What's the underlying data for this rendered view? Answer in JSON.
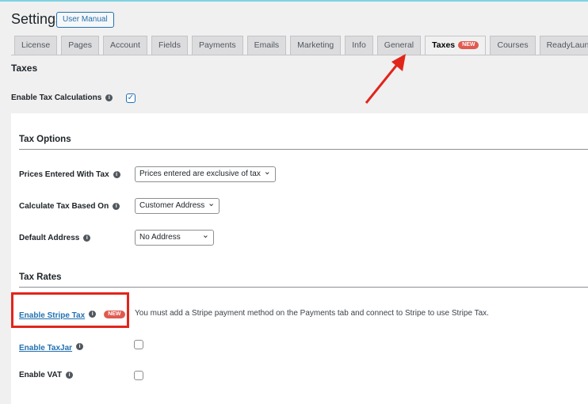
{
  "header": {
    "title": "Settings",
    "manual_button": "User Manual"
  },
  "tabs": [
    {
      "label": "License"
    },
    {
      "label": "Pages"
    },
    {
      "label": "Account"
    },
    {
      "label": "Fields"
    },
    {
      "label": "Payments"
    },
    {
      "label": "Emails"
    },
    {
      "label": "Marketing"
    },
    {
      "label": "Info"
    },
    {
      "label": "General"
    },
    {
      "label": "Taxes",
      "badge": "NEW",
      "active": true
    },
    {
      "label": "Courses"
    },
    {
      "label": "ReadyLaunch™"
    }
  ],
  "section_title": "Taxes",
  "enable_tax": {
    "label": "Enable Tax Calculations",
    "checked": true
  },
  "tax_options": {
    "heading": "Tax Options",
    "prices": {
      "label": "Prices Entered With Tax",
      "value": "Prices entered are exclusive of tax"
    },
    "calc": {
      "label": "Calculate Tax Based On",
      "value": "Customer Address"
    },
    "address": {
      "label": "Default Address",
      "value": "No Address"
    }
  },
  "tax_rates": {
    "heading": "Tax Rates",
    "stripe": {
      "label": "Enable Stripe Tax",
      "badge": "NEW",
      "note": "You must add a Stripe payment method on the Payments tab and connect to Stripe to use Stripe Tax."
    },
    "taxjar": {
      "label": "Enable TaxJar",
      "checked": false
    },
    "vat": {
      "label": "Enable VAT",
      "checked": false
    }
  },
  "colors": {
    "accent": "#2271b1",
    "badge": "#e05a4f",
    "annotation": "#e1251b"
  }
}
